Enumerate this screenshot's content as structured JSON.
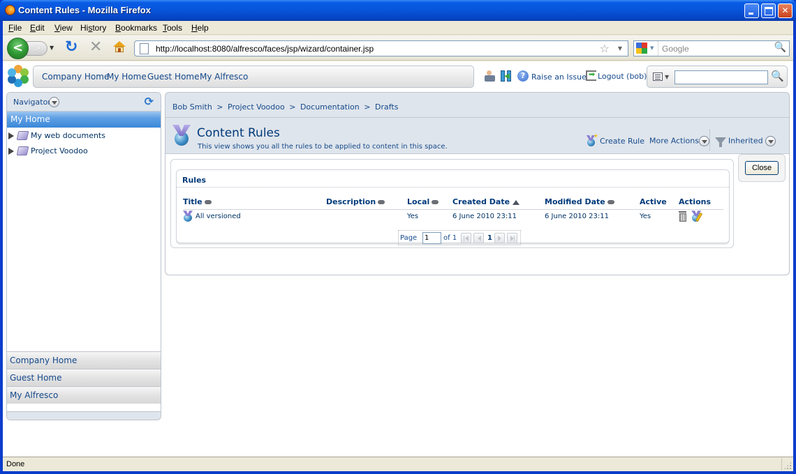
{
  "window": {
    "title": "Content Rules - Mozilla Firefox",
    "controls": [
      "minimize",
      "maximize",
      "close"
    ]
  },
  "menubar": {
    "items": [
      {
        "label": "File",
        "accel": "F"
      },
      {
        "label": "Edit",
        "accel": "E"
      },
      {
        "label": "View",
        "accel": "V"
      },
      {
        "label": "History",
        "accel": "s"
      },
      {
        "label": "Bookmarks",
        "accel": "B"
      },
      {
        "label": "Tools",
        "accel": "T"
      },
      {
        "label": "Help",
        "accel": "H"
      }
    ]
  },
  "toolbar": {
    "url": "http://localhost:8080/alfresco/faces/jsp/wizard/container.jsp",
    "search_placeholder": "Google",
    "icons": [
      "back-icon",
      "forward-icon",
      "reload-icon",
      "stop-icon",
      "home-icon",
      "bookmark-star-icon",
      "search-magnifier-icon"
    ]
  },
  "header": {
    "nav_links": [
      "Company Home",
      "My Home",
      "Guest Home",
      "My Alfresco"
    ],
    "raise_issue": "Raise an Issue",
    "logout": "Logout (bob)",
    "search_value": ""
  },
  "navigator": {
    "title": "Navigator",
    "active": "My Home",
    "tree": [
      "My web documents",
      "Project Voodoo"
    ],
    "shelves": [
      "Company Home",
      "Guest Home",
      "My Alfresco"
    ]
  },
  "main": {
    "breadcrumb": [
      "Bob Smith",
      "Project Voodoo",
      "Documentation",
      "Drafts"
    ],
    "breadcrumb_sep": ">",
    "title": "Content Rules",
    "description": "This view shows you all the rules to be applied to content in this space.",
    "actions": {
      "create_rule": "Create Rule",
      "more_actions": "More Actions",
      "filter": "Inherited"
    },
    "close_label": "Close"
  },
  "rules": {
    "heading": "Rules",
    "columns": [
      {
        "label": "Title",
        "sort": "none"
      },
      {
        "label": "Description",
        "sort": "none"
      },
      {
        "label": "Local",
        "sort": "none"
      },
      {
        "label": "Created Date",
        "sort": "ascending"
      },
      {
        "label": "Modified Date",
        "sort": "none"
      },
      {
        "label": "Active",
        "sort": null
      },
      {
        "label": "Actions",
        "sort": null
      }
    ],
    "rows": [
      {
        "title": "All versioned",
        "description": "",
        "local": "Yes",
        "created": "6 June 2010 23:11",
        "modified": "6 June 2010 23:11",
        "active": "Yes",
        "actions": [
          "delete-icon",
          "edit-rule-icon"
        ]
      }
    ],
    "pager": {
      "page_label": "Page",
      "page_value": "1",
      "of_label": "of 1",
      "current": "1"
    }
  },
  "status": {
    "text": "Done"
  }
}
